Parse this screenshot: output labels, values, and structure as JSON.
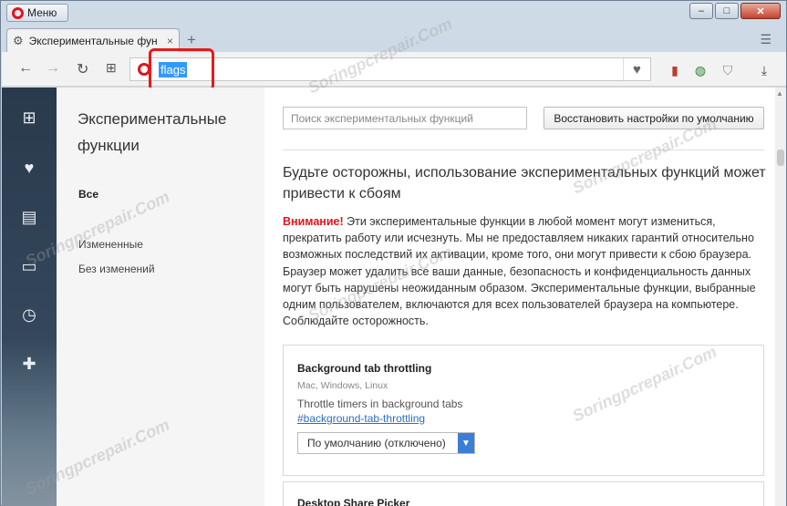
{
  "titlebar": {
    "menu_label": "Меню",
    "controls": {
      "minimize": "‒",
      "maximize": "□",
      "close": "✕"
    }
  },
  "tabs": [
    {
      "title": "Экспериментальные фун",
      "icon": "gear-icon",
      "close": "×"
    }
  ],
  "tabstrip": {
    "new_tab": "+",
    "tab_menu": "☰"
  },
  "toolbar": {
    "back": "←",
    "forward": "→",
    "reload": "↻",
    "speed_dial": "⊞",
    "url": "flags",
    "bookmark": "♥",
    "extensions": [
      "bookmarks-icon",
      "vpn-globe-icon",
      "shield-icon",
      "download-icon"
    ]
  },
  "sidebar": {
    "items": [
      "speed-dial-icon",
      "heart-icon",
      "news-icon",
      "devices-icon",
      "history-icon",
      "extensions-icon"
    ]
  },
  "page": {
    "title": "Экспериментальные функции",
    "nav": {
      "all": "Все",
      "changed": "Измененные",
      "unchanged": "Без изменений"
    },
    "search_placeholder": "Поиск экспериментальных функций",
    "reset_label": "Восстановить настройки по умолчанию",
    "warning_title": "Будьте осторожны, использование экспериментальных функций может привести к сбоям",
    "warning_attention": "Внимание!",
    "warning_text": " Эти экспериментальные функции в любой момент могут измениться, прекратить работу или исчезнуть. Мы не предоставляем никаких гарантий относительно возможных последствий их активации, кроме того, они могут привести к сбою браузера. Браузер может удалить все ваши данные, безопасность и конфиденциальность данных могут быть нарушены неожиданным образом. Экспериментальные функции, выбранные одним пользователем, включаются для всех пользователей браузера на компьютере. Соблюдайте осторожность."
  },
  "flags": [
    {
      "title": "Background tab throttling",
      "platforms": "Mac, Windows, Linux",
      "description": "Throttle timers in background tabs",
      "link": "#background-tab-throttling",
      "selected": "По умолчанию (отключено)"
    },
    {
      "title": "Desktop Share Picker"
    }
  ],
  "watermark": "Soringpcrepair.Com",
  "colors": {
    "accent": "#e0141e",
    "highlight_box": "#e51a1a",
    "link": "#2a6fc4",
    "select_arrow": "#3b7fd4"
  }
}
